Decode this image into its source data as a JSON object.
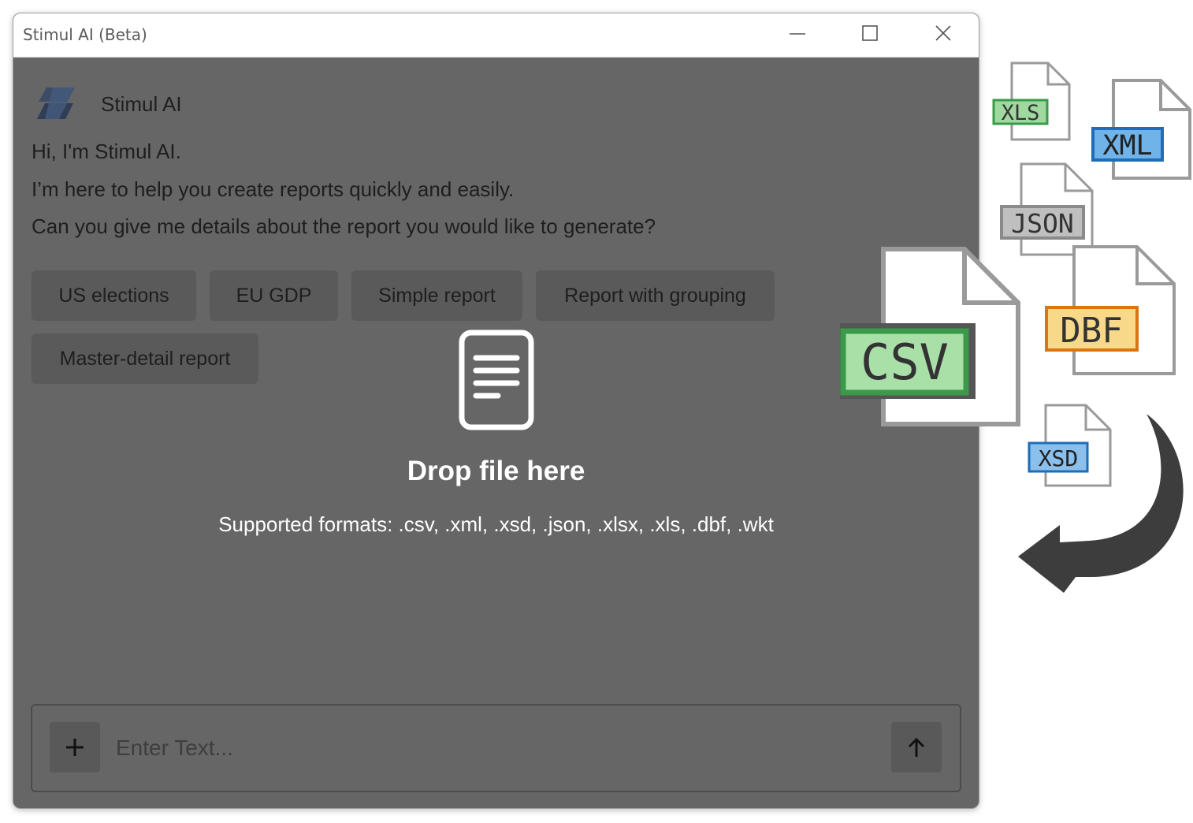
{
  "window": {
    "title": "Stimul AI (Beta)",
    "controls": [
      "minimize-icon",
      "maximize-icon",
      "close-icon"
    ]
  },
  "chat": {
    "app_name": "Stimul AI",
    "messages": [
      "Hi, I'm Stimul AI.",
      "I’m here to help you create reports quickly and easily.",
      "Can you give me details about the report you would like to generate?"
    ],
    "suggestions": [
      "US elections",
      "EU GDP",
      "Simple report",
      "Report with grouping",
      "Master-detail report"
    ]
  },
  "drop_overlay": {
    "icon": "document-icon",
    "title": "Drop file here",
    "formats": "Supported formats: .csv, .xml, .xsd, .json, .xlsx, .xls, .dbf, .wkt"
  },
  "input": {
    "placeholder": "Enter Text...",
    "add_icon": "plus-icon",
    "send_icon": "arrow-up-icon"
  },
  "file_badges": {
    "xls": "XLS",
    "xml": "XML",
    "json": "JSON",
    "csv": "CSV",
    "dbf": "DBF",
    "xsd": "XSD"
  },
  "colors": {
    "overlay": "#666666",
    "xls": "#9fd99f",
    "xml": "#6fb3e8",
    "json": "#bfbfbf",
    "csv": "#a8e0a8",
    "dbf": "#f8d98a",
    "xsd": "#8cc0ec"
  }
}
